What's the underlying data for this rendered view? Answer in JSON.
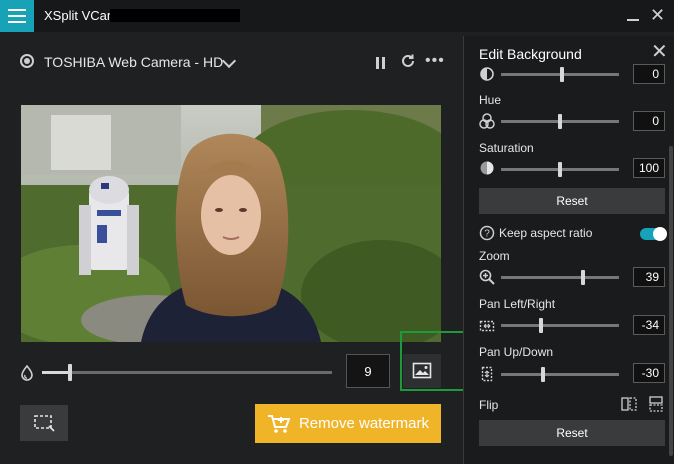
{
  "app": {
    "title": "XSplit VCam"
  },
  "camera": {
    "name": "TOSHIBA Web Camera - HD"
  },
  "preview": {
    "blur_value": "9",
    "blur_level": 0.09
  },
  "actions": {
    "remove_watermark": "Remove watermark"
  },
  "panel": {
    "title": "Edit Background",
    "top_value": "0",
    "hue": {
      "label": "Hue",
      "value": "0",
      "level": 0.5
    },
    "saturation": {
      "label": "Saturation",
      "value": "100",
      "level": 0.5
    },
    "reset1": "Reset",
    "keep_aspect": {
      "label": "Keep aspect ratio",
      "on": true
    },
    "zoom": {
      "label": "Zoom",
      "value": "39",
      "level": 0.7
    },
    "pan_lr": {
      "label": "Pan Left/Right",
      "value": "-34",
      "level": 0.33
    },
    "pan_ud": {
      "label": "Pan Up/Down",
      "value": "-30",
      "level": 0.35
    },
    "flip": {
      "label": "Flip"
    },
    "reset2": "Reset"
  },
  "colors": {
    "accent": "#17a2b8",
    "watermark": "#f0b429",
    "highlight": "#1e9a3a"
  }
}
